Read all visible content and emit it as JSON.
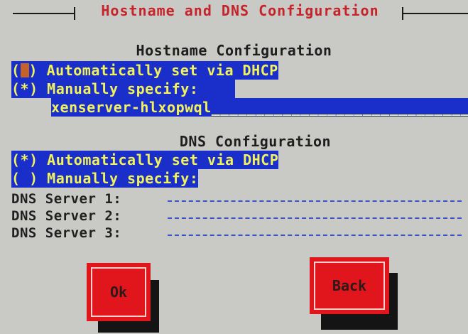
{
  "dialog": {
    "title": "Hostname and DNS Configuration"
  },
  "hostname": {
    "heading": "Hostname Configuration",
    "option_dhcp": {
      "marker": "( )",
      "label": "Automatically set via DHCP",
      "selected": false
    },
    "option_manual": {
      "marker": "(*)",
      "label": "Manually specify:",
      "selected": true
    },
    "value": "xenserver-hlxopwql"
  },
  "dns": {
    "heading": "DNS Configuration",
    "option_dhcp": {
      "marker": "(*)",
      "label": "Automatically set via DHCP",
      "selected": true
    },
    "option_manual": {
      "marker": "( )",
      "label": "Manually specify:",
      "selected": false
    },
    "servers": [
      {
        "label": "DNS Server 1:",
        "value": ""
      },
      {
        "label": "DNS Server 2:",
        "value": ""
      },
      {
        "label": "DNS Server 3:",
        "value": ""
      }
    ]
  },
  "buttons": {
    "ok": "Ok",
    "back": "Back"
  },
  "colors": {
    "background": "#c9c9c6",
    "highlight": "#1a2fc9",
    "highlight_text": "#f2f25a",
    "title_text": "#c4242a",
    "button": "#e0161c"
  }
}
